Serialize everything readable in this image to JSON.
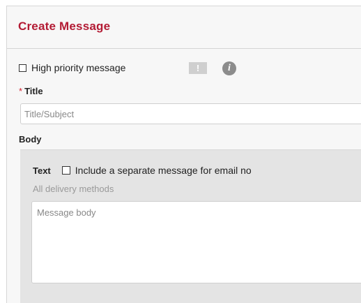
{
  "header": {
    "title": "Create Message"
  },
  "priority": {
    "label": "High priority message",
    "checked": false,
    "badge_icon": "exclamation-icon",
    "badge_glyph": "!",
    "info_icon": "info-icon",
    "info_glyph": "i"
  },
  "title_field": {
    "required_marker": "*",
    "label": "Title",
    "placeholder": "Title/Subject",
    "value": ""
  },
  "body": {
    "label": "Body",
    "text_label": "Text",
    "separate_email_label": "Include a separate message for email no",
    "separate_email_checked": false,
    "delivery_label": "All delivery methods",
    "message_placeholder": "Message body",
    "message_value": ""
  },
  "colors": {
    "accent": "#b31b34",
    "required": "#d0202e",
    "panel_bg": "#f7f7f7",
    "body_bg": "#e4e4e4"
  }
}
